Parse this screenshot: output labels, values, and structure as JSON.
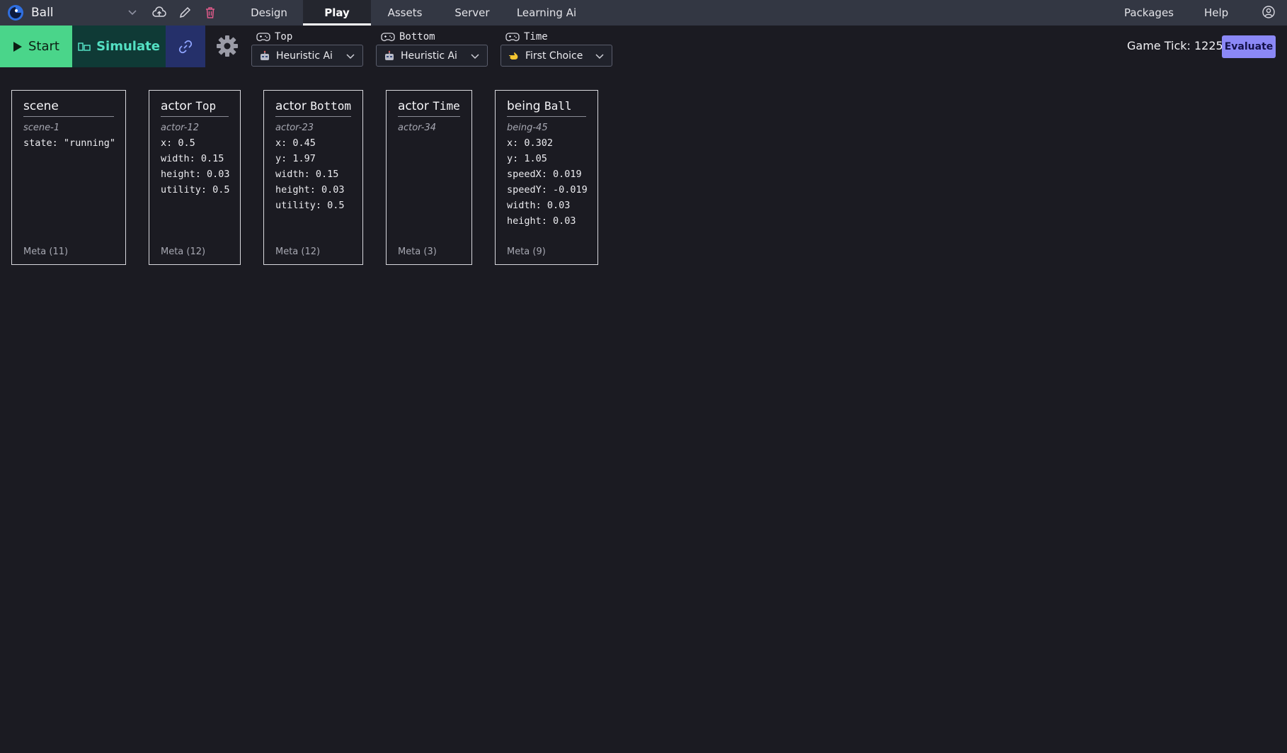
{
  "header": {
    "project_name": "Ball",
    "tabs": [
      {
        "label": "Design",
        "active": false
      },
      {
        "label": "Play",
        "active": true
      },
      {
        "label": "Assets",
        "active": false
      },
      {
        "label": "Server",
        "active": false
      },
      {
        "label": "Learning Ai",
        "active": false
      }
    ],
    "right_links": [
      "Packages",
      "Help"
    ],
    "icons": [
      "app-logo-icon",
      "chevron-down-icon",
      "cloud-upload-icon",
      "pencil-icon",
      "trash-icon",
      "account-icon"
    ]
  },
  "toolbar": {
    "start_label": "Start",
    "simulate_label": "Simulate",
    "controllers": [
      {
        "label": "Top",
        "selected": "Heuristic Ai",
        "icon": "robot-icon"
      },
      {
        "label": "Bottom",
        "selected": "Heuristic Ai",
        "icon": "robot-icon"
      },
      {
        "label": "Time",
        "selected": "First Choice",
        "icon": "pointing-hand-icon"
      }
    ],
    "game_tick_label": "Game Tick: 1225",
    "evaluate_label": "Evaluate"
  },
  "colors": {
    "start_bg": "#4ad58a",
    "simulate_bg": "#0f3a36",
    "link_bg": "#25306a",
    "evaluate_bg": "#8b88f6",
    "trash": "#e05a8a"
  },
  "cards": [
    {
      "kind": "scene",
      "name": "",
      "id": "scene-1",
      "props": [
        "state: \"running\""
      ],
      "meta": "Meta (11)"
    },
    {
      "kind": "actor",
      "name": "Top",
      "id": "actor-12",
      "props": [
        "x: 0.5",
        "width: 0.15",
        "height: 0.03",
        "utility: 0.5"
      ],
      "meta": "Meta (12)"
    },
    {
      "kind": "actor",
      "name": "Bottom",
      "id": "actor-23",
      "props": [
        "x: 0.45",
        "y: 1.97",
        "width: 0.15",
        "height: 0.03",
        "utility: 0.5"
      ],
      "meta": "Meta (12)"
    },
    {
      "kind": "actor",
      "name": "Time",
      "id": "actor-34",
      "props": [],
      "meta": "Meta (3)"
    },
    {
      "kind": "being",
      "name": "Ball",
      "id": "being-45",
      "props": [
        "x: 0.302",
        "y: 1.05",
        "speedX: 0.019",
        "speedY: -0.019",
        "width: 0.03",
        "height: 0.03"
      ],
      "meta": "Meta (9)"
    }
  ]
}
